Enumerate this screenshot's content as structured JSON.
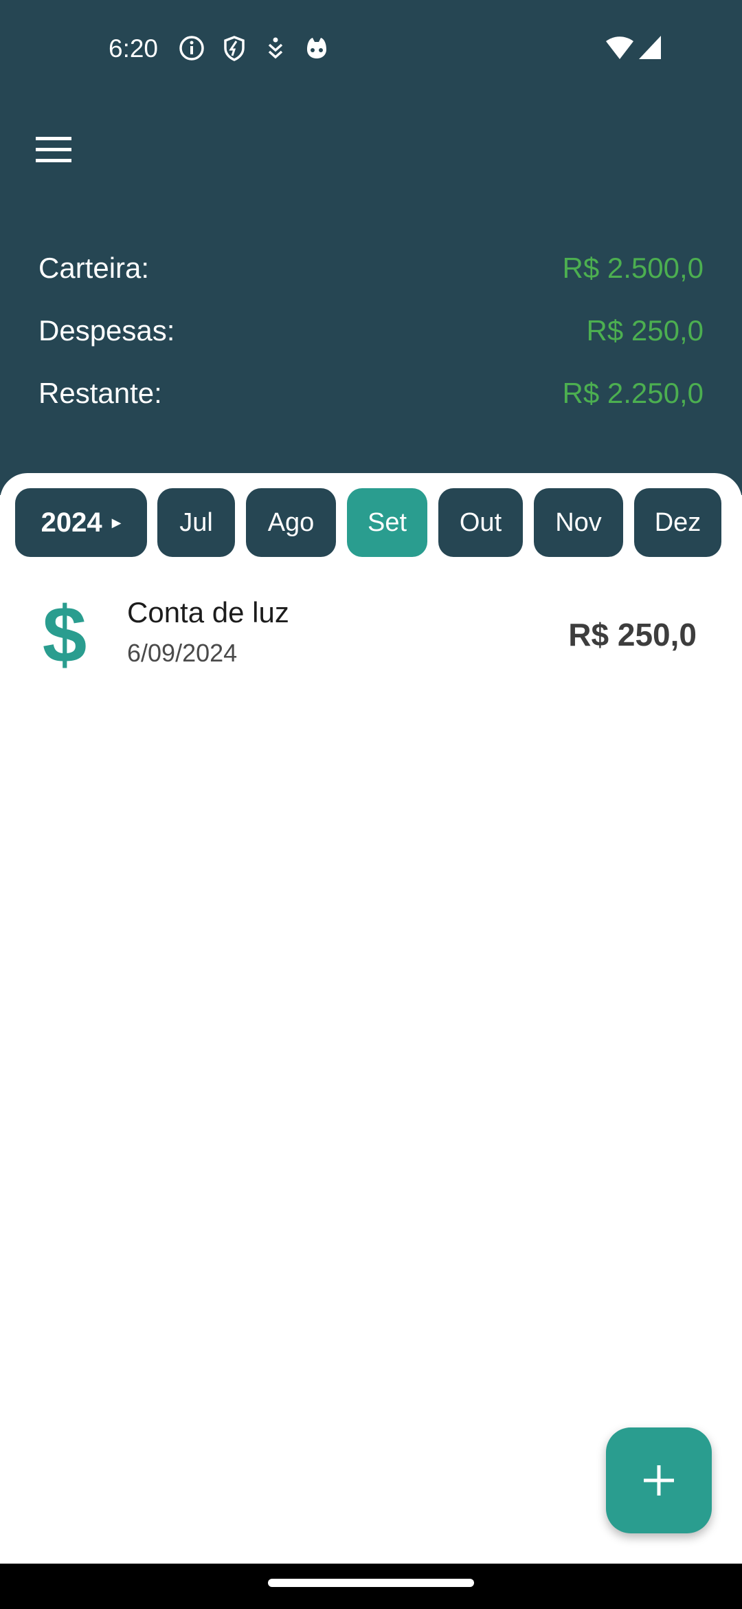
{
  "status_bar": {
    "time": "6:20",
    "icons": [
      "info-icon",
      "shield-icon",
      "download-icon",
      "cat-face-icon",
      "wifi-icon",
      "signal-icon"
    ]
  },
  "header": {
    "menu_icon": "hamburger-menu-icon",
    "summary": [
      {
        "label": "Carteira:",
        "value": "R$ 2.500,0"
      },
      {
        "label": "Despesas:",
        "value": "R$ 250,0"
      },
      {
        "label": "Restante:",
        "value": "R$ 2.250,0"
      }
    ]
  },
  "filters": {
    "year": "2024",
    "months": [
      {
        "label": "Jul",
        "selected": false
      },
      {
        "label": "Ago",
        "selected": false
      },
      {
        "label": "Set",
        "selected": true
      },
      {
        "label": "Out",
        "selected": false
      },
      {
        "label": "Nov",
        "selected": false
      },
      {
        "label": "Dez",
        "selected": false
      }
    ]
  },
  "expenses": [
    {
      "icon": "dollar-sign-icon",
      "symbol": "$",
      "title": "Conta de luz",
      "date": "6/09/2024",
      "amount": "R$ 250,0"
    }
  ],
  "fab": {
    "icon": "plus-icon"
  },
  "colors": {
    "header_bg": "#264653",
    "chip_bg": "#264653",
    "accent": "#2a9d8f",
    "money_green": "#4caf50"
  }
}
